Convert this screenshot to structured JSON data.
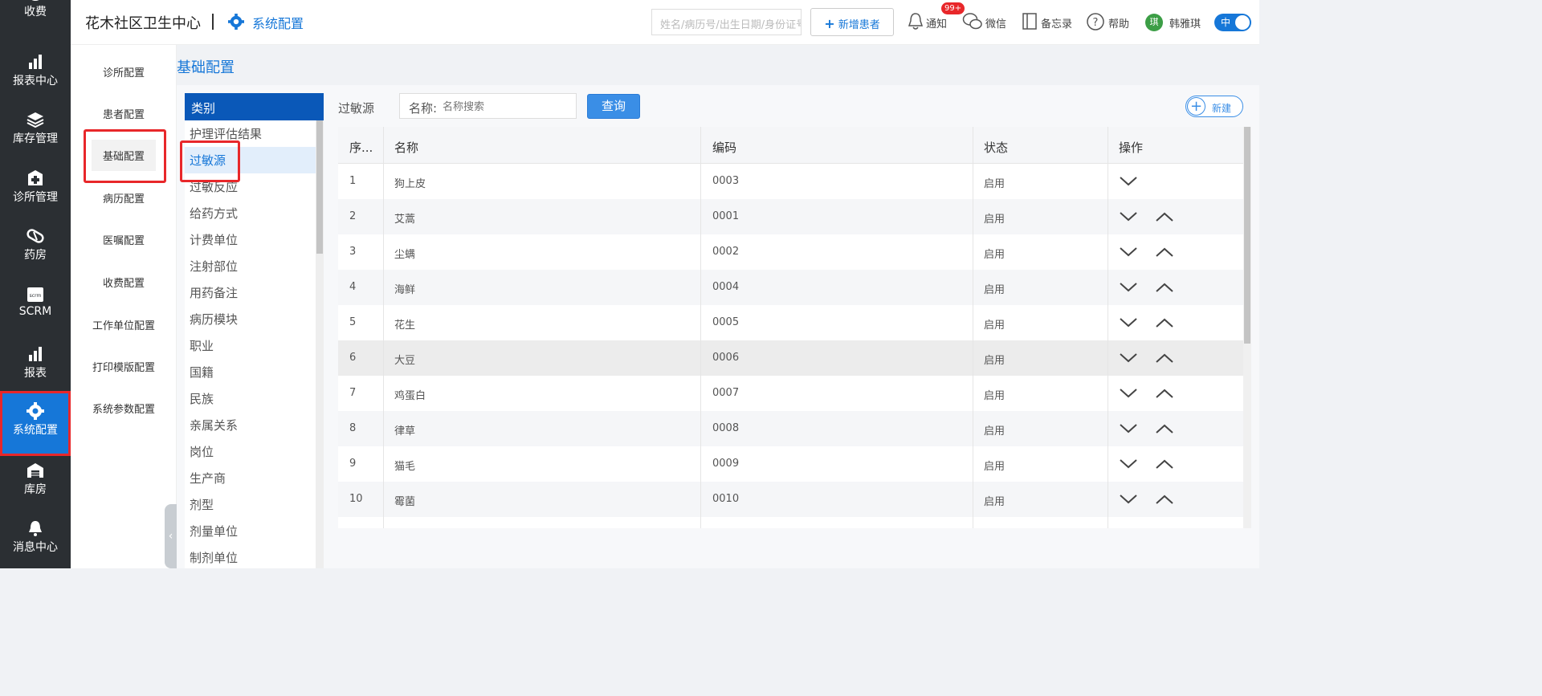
{
  "leftnav": {
    "items": [
      {
        "label": "收费",
        "icon": "yuan-icon"
      },
      {
        "label": "报表中心",
        "icon": "bar-chart-icon"
      },
      {
        "label": "库存管理",
        "icon": "layers-icon"
      },
      {
        "label": "诊所管理",
        "icon": "medical-plus-icon"
      },
      {
        "label": "药房",
        "icon": "pill-icon"
      },
      {
        "label": "SCRM",
        "icon": "scrm-icon",
        "icon_text": "scrm"
      },
      {
        "label": "报表",
        "icon": "bar-chart-icon"
      },
      {
        "label": "系统配置",
        "icon": "gear-icon",
        "active": true
      },
      {
        "label": "库房",
        "icon": "warehouse-icon"
      },
      {
        "label": "消息中心",
        "icon": "bell-icon"
      }
    ]
  },
  "header": {
    "clinic": "花木社区卫生中心",
    "separator": "|",
    "section": "系统配置",
    "search_placeholder": "姓名/病历号/出生日期/身份证号",
    "new_patient": "新增患者",
    "notify": "通知",
    "notify_badge": "99+",
    "wechat": "微信",
    "memo": "备忘录",
    "help": "帮助",
    "avatar_text": "琪",
    "user": "韩雅琪",
    "toggle": "中"
  },
  "submenu": {
    "items": [
      "诊所配置",
      "患者配置",
      "基础配置",
      "病历配置",
      "医嘱配置",
      "收费配置",
      "工作单位配置",
      "打印模版配置",
      "系统参数配置"
    ],
    "active": "基础配置"
  },
  "page_title": "基础配置",
  "category": {
    "header": "类别",
    "items": [
      "护理评估结果",
      "过敏源",
      "过敏反应",
      "给药方式",
      "计费单位",
      "注射部位",
      "用药备注",
      "病历模块",
      "职业",
      "国籍",
      "民族",
      "亲属关系",
      "岗位",
      "生产商",
      "剂型",
      "剂量单位",
      "制剂单位"
    ],
    "active": "过敏源"
  },
  "toolbar": {
    "current": "过敏源",
    "name_label": "名称:",
    "name_placeholder": "名称搜索",
    "query": "查询",
    "new": "新建"
  },
  "table": {
    "columns": [
      "序...",
      "名称",
      "编码",
      "状态",
      "操作"
    ],
    "rows": [
      {
        "no": "1",
        "name": "狗上皮",
        "code": "0003",
        "status": "启用",
        "has_up": false
      },
      {
        "no": "2",
        "name": "艾蒿",
        "code": "0001",
        "status": "启用",
        "has_up": true
      },
      {
        "no": "3",
        "name": "尘螨",
        "code": "0002",
        "status": "启用",
        "has_up": true
      },
      {
        "no": "4",
        "name": "海鲜",
        "code": "0004",
        "status": "启用",
        "has_up": true
      },
      {
        "no": "5",
        "name": "花生",
        "code": "0005",
        "status": "启用",
        "has_up": true
      },
      {
        "no": "6",
        "name": "大豆",
        "code": "0006",
        "status": "启用",
        "has_up": true
      },
      {
        "no": "7",
        "name": "鸡蛋白",
        "code": "0007",
        "status": "启用",
        "has_up": true
      },
      {
        "no": "8",
        "name": "律草",
        "code": "0008",
        "status": "启用",
        "has_up": true
      },
      {
        "no": "9",
        "name": "猫毛",
        "code": "0009",
        "status": "启用",
        "has_up": true
      },
      {
        "no": "10",
        "name": "霉菌",
        "code": "0010",
        "status": "启用",
        "has_up": true
      }
    ]
  },
  "colors": {
    "accent": "#1677d8",
    "sidebar": "#2b2f33",
    "highlight_box": "#e8272a",
    "category_header": "#0a58b8"
  }
}
